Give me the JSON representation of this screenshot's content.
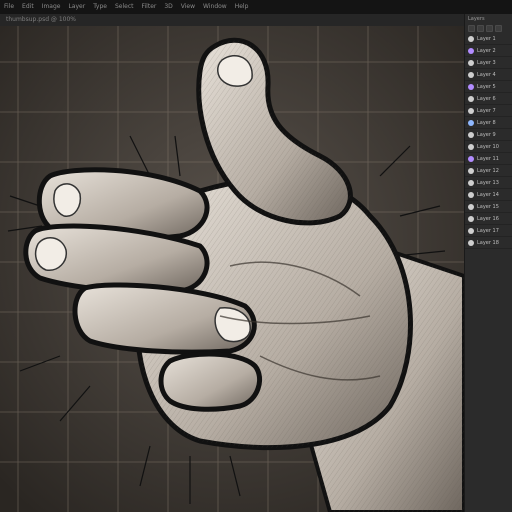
{
  "menubar": {
    "items": [
      "File",
      "Edit",
      "Image",
      "Layer",
      "Type",
      "Select",
      "Filter",
      "3D",
      "View",
      "Window",
      "Help"
    ]
  },
  "document": {
    "title": "thumbsup.psd @ 100%"
  },
  "panel": {
    "heading": "Layers",
    "layers": [
      {
        "name": "Layer 1",
        "color": "#cfcfcf"
      },
      {
        "name": "Layer 2",
        "color": "#b28cff"
      },
      {
        "name": "Layer 3",
        "color": "#cfcfcf"
      },
      {
        "name": "Layer 4",
        "color": "#cfcfcf"
      },
      {
        "name": "Layer 5",
        "color": "#b28cff"
      },
      {
        "name": "Layer 6",
        "color": "#cfcfcf"
      },
      {
        "name": "Layer 7",
        "color": "#cfcfcf"
      },
      {
        "name": "Layer 8",
        "color": "#8fb8ff"
      },
      {
        "name": "Layer 9",
        "color": "#cfcfcf"
      },
      {
        "name": "Layer 10",
        "color": "#cfcfcf"
      },
      {
        "name": "Layer 11",
        "color": "#b28cff"
      },
      {
        "name": "Layer 12",
        "color": "#cfcfcf"
      },
      {
        "name": "Layer 13",
        "color": "#cfcfcf"
      },
      {
        "name": "Layer 14",
        "color": "#cfcfcf"
      },
      {
        "name": "Layer 15",
        "color": "#cfcfcf"
      },
      {
        "name": "Layer 16",
        "color": "#cfcfcf"
      },
      {
        "name": "Layer 17",
        "color": "#cfcfcf"
      },
      {
        "name": "Layer 18",
        "color": "#cfcfcf"
      }
    ]
  },
  "colors": {
    "canvas_bg": "#2e2a26",
    "grid": "#8a7e70",
    "accent_purple": "#b28cff"
  }
}
